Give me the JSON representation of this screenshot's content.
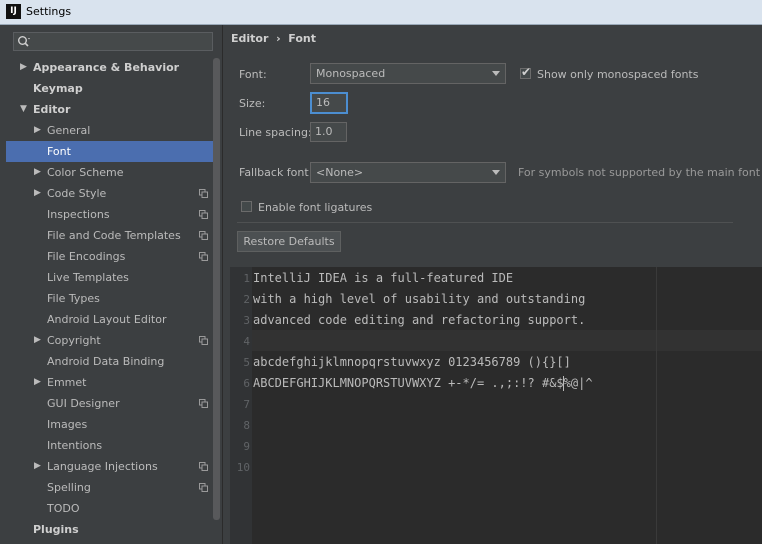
{
  "window": {
    "title": "Settings",
    "app_icon_text": "IJ"
  },
  "sidebar": {
    "search_value": "",
    "items": [
      {
        "label": "Appearance & Behavior",
        "level": 0,
        "arrow": "▶",
        "bold": true
      },
      {
        "label": "Keymap",
        "level": 0,
        "arrow": "",
        "bold": true
      },
      {
        "label": "Editor",
        "level": 0,
        "arrow": "▼",
        "bold": true
      },
      {
        "label": "General",
        "level": 1,
        "arrow": "▶"
      },
      {
        "label": "Font",
        "level": 1,
        "arrow": "",
        "selected": true
      },
      {
        "label": "Color Scheme",
        "level": 1,
        "arrow": "▶"
      },
      {
        "label": "Code Style",
        "level": 1,
        "arrow": "▶",
        "copy": true
      },
      {
        "label": "Inspections",
        "level": 1,
        "arrow": "",
        "copy": true
      },
      {
        "label": "File and Code Templates",
        "level": 1,
        "arrow": "",
        "copy": true
      },
      {
        "label": "File Encodings",
        "level": 1,
        "arrow": "",
        "copy": true
      },
      {
        "label": "Live Templates",
        "level": 1,
        "arrow": ""
      },
      {
        "label": "File Types",
        "level": 1,
        "arrow": ""
      },
      {
        "label": "Android Layout Editor",
        "level": 1,
        "arrow": ""
      },
      {
        "label": "Copyright",
        "level": 1,
        "arrow": "▶",
        "copy": true
      },
      {
        "label": "Android Data Binding",
        "level": 1,
        "arrow": ""
      },
      {
        "label": "Emmet",
        "level": 1,
        "arrow": "▶"
      },
      {
        "label": "GUI Designer",
        "level": 1,
        "arrow": "",
        "copy": true
      },
      {
        "label": "Images",
        "level": 1,
        "arrow": ""
      },
      {
        "label": "Intentions",
        "level": 1,
        "arrow": ""
      },
      {
        "label": "Language Injections",
        "level": 1,
        "arrow": "▶",
        "copy": true
      },
      {
        "label": "Spelling",
        "level": 1,
        "arrow": "",
        "copy": true
      },
      {
        "label": "TODO",
        "level": 1,
        "arrow": ""
      },
      {
        "label": "Plugins",
        "level": 0,
        "arrow": "",
        "bold": true
      }
    ]
  },
  "breadcrumb": {
    "parent": "Editor",
    "separator": "›",
    "current": "Font"
  },
  "form": {
    "font_label": "Font:",
    "font_value": "Monospaced",
    "monospaced_only_label": "Show only monospaced fonts",
    "monospaced_only_checked": true,
    "size_label": "Size:",
    "size_value": "16",
    "line_spacing_label": "Line spacing:",
    "line_spacing_value": "1.0",
    "fallback_label": "Fallback font:",
    "fallback_value": "<None>",
    "fallback_hint": "For symbols not supported by the main font",
    "ligatures_label": "Enable font ligatures",
    "ligatures_checked": false,
    "restore_button": "Restore Defaults"
  },
  "preview": {
    "lines": [
      {
        "num": "1",
        "text": "IntelliJ IDEA is a full-featured IDE"
      },
      {
        "num": "2",
        "text": "with a high level of usability and outstanding"
      },
      {
        "num": "3",
        "text": "advanced code editing and refactoring support."
      },
      {
        "num": "4",
        "text": ""
      },
      {
        "num": "5",
        "text": "abcdefghijklmnopqrstuvwxyz 0123456789 (){}[]"
      },
      {
        "num": "6",
        "text": "ABCDEFGHIJKLMNOPQRSTUVWXYZ +-*/= .,;:!? #&$%@|^"
      },
      {
        "num": "7",
        "text": ""
      },
      {
        "num": "8",
        "text": ""
      },
      {
        "num": "9",
        "text": ""
      },
      {
        "num": "10",
        "text": ""
      }
    ]
  },
  "colors": {
    "background": "#3c3f41",
    "selection": "#4b6eaf",
    "editor_background": "#2b2b2b",
    "focus_border": "#4c8ed1"
  }
}
